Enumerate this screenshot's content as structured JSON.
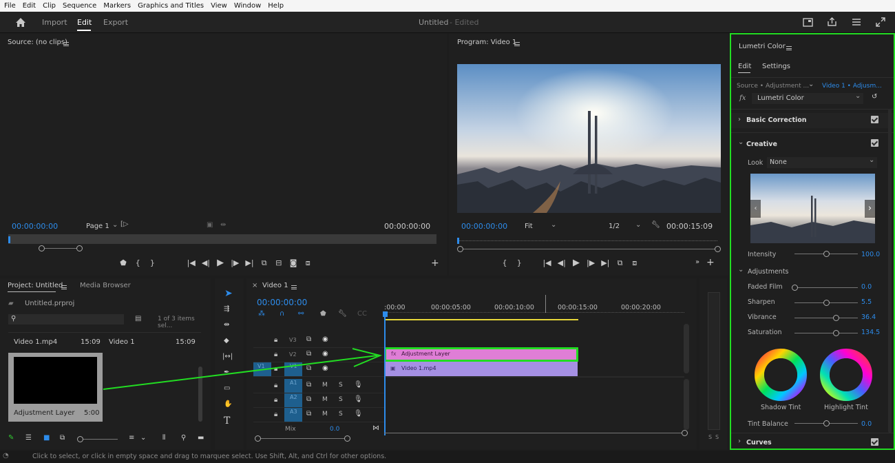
{
  "menu": [
    "File",
    "Edit",
    "Clip",
    "Sequence",
    "Markers",
    "Graphics and Titles",
    "View",
    "Window",
    "Help"
  ],
  "header": {
    "tabs": [
      "Import",
      "Edit",
      "Export"
    ],
    "active_tab": "Edit",
    "title": "Untitled",
    "edited": "- Edited"
  },
  "source_monitor": {
    "title": "Source: (no clips)",
    "timecode_left": "00:00:00:00",
    "page": "Page 1",
    "timecode_right": "00:00:00:00"
  },
  "program_monitor": {
    "title": "Program: Video 1",
    "timecode_left": "00:00:00:00",
    "fit": "Fit",
    "resolution": "1/2",
    "timecode_right": "00:00:15:09"
  },
  "project": {
    "tab_project": "Project: Untitled",
    "tab_media": "Media Browser",
    "file": "Untitled.prproj",
    "items_count": "1 of 3 items sel...",
    "items": [
      {
        "name": "Video 1.mp4",
        "duration": "15:09"
      },
      {
        "name": "Video 1",
        "duration": "15:09"
      },
      {
        "name": "Adjustment Layer",
        "duration": "5:00"
      }
    ]
  },
  "timeline": {
    "tab": "Video 1",
    "timecode": "00:00:00:00",
    "ruler": [
      ":00:00",
      "00:00:05:00",
      "00:00:10:00",
      "00:00:15:00",
      "00:00:20:00"
    ],
    "video_tracks": [
      "V3",
      "V2",
      "V1"
    ],
    "audio_tracks": [
      "A1",
      "A2",
      "A3"
    ],
    "source_patch_v": "V1",
    "source_patch_a": "A1",
    "mix_label": "Mix",
    "mix_value": "0.0",
    "clips": {
      "adjustment": "Adjustment Layer",
      "video": "Video 1.mp4"
    },
    "track_btn_m": "M",
    "track_btn_s": "S"
  },
  "lumetri": {
    "title": "Lumetri Color",
    "tabs": [
      "Edit",
      "Settings"
    ],
    "source": "Source • Adjustment ...",
    "target": "Video 1 • Adjusm...",
    "effect": "Lumetri Color",
    "sections": {
      "basic": "Basic Correction",
      "creative": "Creative",
      "adjustments": "Adjustments",
      "curves": "Curves"
    },
    "look_label": "Look",
    "look_value": "None",
    "intensity_label": "Intensity",
    "intensity_value": "100.0",
    "sliders": [
      {
        "label": "Faded Film",
        "value": "0.0",
        "level": 0.0
      },
      {
        "label": "Sharpen",
        "value": "5.5",
        "level": 0.5
      },
      {
        "label": "Vibrance",
        "value": "36.4",
        "level": 0.65
      },
      {
        "label": "Saturation",
        "value": "134.5",
        "level": 0.65
      }
    ],
    "wheels": [
      "Shadow Tint",
      "Highlight Tint"
    ],
    "tint_balance_label": "Tint Balance",
    "tint_balance_value": "0.0"
  },
  "status_text": "Click to select, or click in empty space and drag to marquee select. Use Shift, Alt, and Ctrl for other options.",
  "audio_meter": {
    "labels": [
      "S",
      "S"
    ]
  },
  "colors": {
    "accent": "#2d8ceb",
    "highlight_green": "#22dd22",
    "adjustment_clip": "#e07ad8",
    "video_clip": "#a28ae0"
  }
}
